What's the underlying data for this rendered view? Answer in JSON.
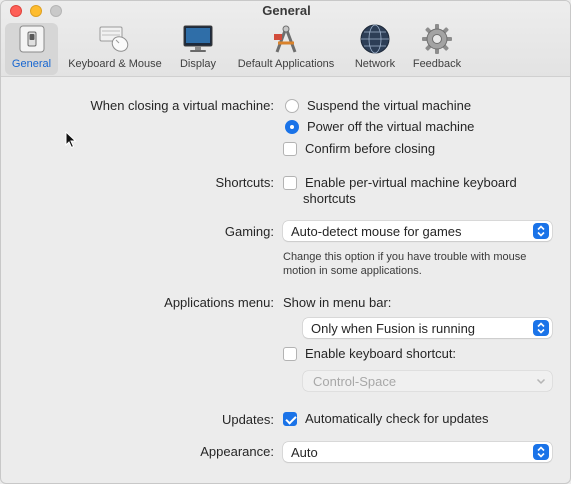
{
  "window": {
    "title": "General"
  },
  "toolbar": {
    "items": [
      {
        "label": "General",
        "icon": "general-switch-icon",
        "selected": true
      },
      {
        "label": "Keyboard & Mouse",
        "icon": "keyboard-mouse-icon"
      },
      {
        "label": "Display",
        "icon": "display-icon"
      },
      {
        "label": "Default Applications",
        "icon": "default-applications-icon"
      },
      {
        "label": "Network",
        "icon": "network-globe-icon"
      },
      {
        "label": "Feedback",
        "icon": "feedback-gear-icon"
      }
    ]
  },
  "closing": {
    "label": "When closing a virtual machine:",
    "suspend": "Suspend the virtual machine",
    "power_off": "Power off the virtual machine",
    "confirm": "Confirm before closing",
    "selected": "power_off",
    "confirm_checked": false
  },
  "shortcuts": {
    "label": "Shortcuts:",
    "option_line1": "Enable per-virtual machine keyboard",
    "option_line2": "shortcuts",
    "checked": false
  },
  "gaming": {
    "label": "Gaming:",
    "value": "Auto-detect mouse for games",
    "help_line1": "Change this option if you have trouble with mouse",
    "help_line2": "motion in some applications."
  },
  "applications_menu": {
    "label": "Applications menu:",
    "show_label": "Show in menu bar:",
    "value": "Only when Fusion is running",
    "keyboard_shortcut_label": "Enable keyboard shortcut:",
    "keyboard_shortcut_checked": false,
    "shortcut_value": "Control-Space"
  },
  "updates": {
    "label": "Updates:",
    "option": "Automatically check for updates",
    "checked": true
  },
  "appearance": {
    "label": "Appearance:",
    "value": "Auto"
  },
  "colors": {
    "accent": "#1a73e8",
    "selected_label": "#1766d1"
  }
}
